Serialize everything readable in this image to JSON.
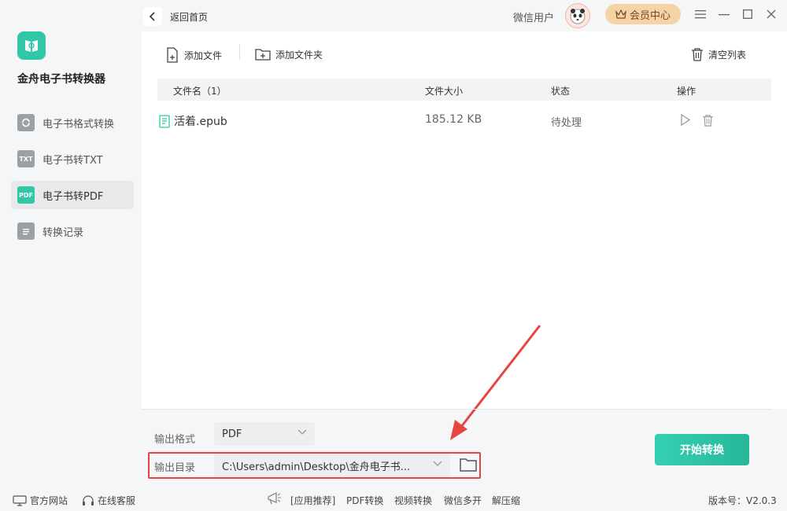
{
  "app": {
    "name": "金舟电子书转换器"
  },
  "sidebar": {
    "items": [
      {
        "icon": "refresh-book-icon",
        "label": "电子书格式转换",
        "active": false
      },
      {
        "icon": "txt-icon",
        "icon_text": "TXT",
        "label": "电子书转TXT",
        "active": false
      },
      {
        "icon": "pdf-icon",
        "icon_text": "PDF",
        "label": "电子书转PDF",
        "active": true
      },
      {
        "icon": "list-icon",
        "label": "转换记录",
        "active": false
      }
    ]
  },
  "header": {
    "back_label": "返回首页",
    "user_name": "微信用户",
    "vip_label": "会员中心"
  },
  "toolbar": {
    "add_file": "添加文件",
    "add_folder": "添加文件夹",
    "clear_list": "清空列表"
  },
  "table": {
    "headers": {
      "name": "文件名（1）",
      "size": "文件大小",
      "status": "状态",
      "actions": "操作"
    },
    "rows": [
      {
        "name": "活着.epub",
        "size": "185.12 KB",
        "status": "待处理"
      }
    ]
  },
  "settings": {
    "format_label": "输出格式",
    "format_value": "PDF",
    "dir_label": "输出目录",
    "dir_value": "C:\\Users\\admin\\Desktop\\金舟电子书...",
    "start_label": "开始转换"
  },
  "footer": {
    "website": "官方网站",
    "support": "在线客服",
    "recommend": "[应用推荐]",
    "links": [
      "PDF转换",
      "视频转换",
      "微信多开",
      "解压缩"
    ],
    "version": "版本号：V2.0.3"
  },
  "colors": {
    "accent": "#2fc7a5",
    "highlight": "#e64540",
    "vip": "#f5d3a6"
  }
}
